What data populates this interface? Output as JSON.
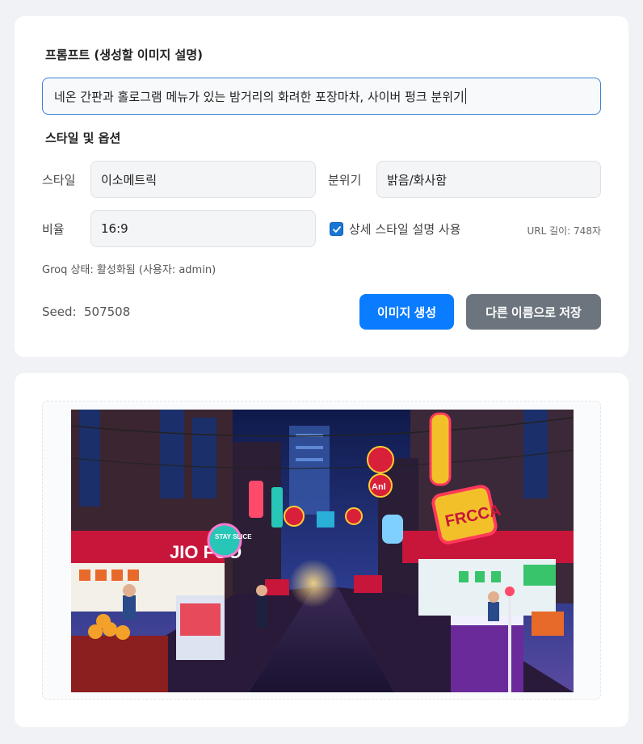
{
  "prompt": {
    "section_title": "프롬프트 (생성할 이미지 설명)",
    "value": "네온 간판과 홀로그램 메뉴가 있는 밤거리의 화려한 포장마차, 사이버 펑크 분위기"
  },
  "options": {
    "section_title": "스타일 및 옵션",
    "style_label": "스타일",
    "style_value": "이소메트릭",
    "mood_label": "분위기",
    "mood_value": "밝음/화사함",
    "ratio_label": "비율",
    "ratio_value": "16:9",
    "detail_checkbox_label": "상세 스타일 설명 사용",
    "detail_checked": true,
    "url_length": "URL 길이: 748자"
  },
  "status": {
    "groq": "Groq 상태: 활성화됨 (사용자: admin)"
  },
  "seed": {
    "label": "Seed:",
    "value": "507508"
  },
  "buttons": {
    "generate": "이미지 생성",
    "save_as": "다른 이름으로 저장"
  },
  "image": {
    "signs": {
      "left_sign": "JIO FOO",
      "round_sign": "STAY SLICE",
      "right_sign": "FRCCA",
      "top_sign": "Anl"
    }
  },
  "colors": {
    "accent": "#0a7cff",
    "secondary": "#6c757d",
    "focus_border": "#3b82d6"
  }
}
